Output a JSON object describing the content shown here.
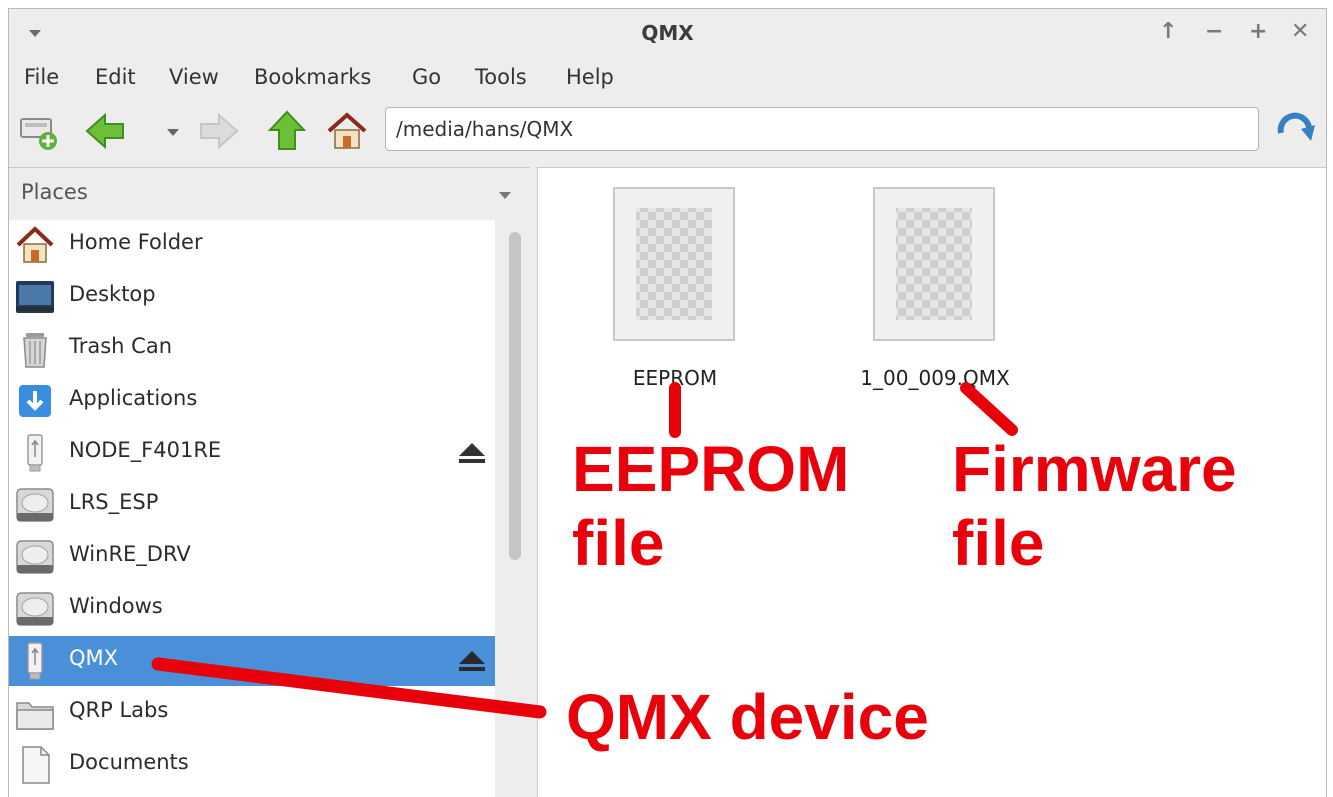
{
  "window": {
    "title": "QMX",
    "controls": [
      "↑",
      "−",
      "+",
      "✕"
    ]
  },
  "menubar": {
    "items": [
      "File",
      "Edit",
      "View",
      "Bookmarks",
      "Go",
      "Tools",
      "Help"
    ]
  },
  "toolbar": {
    "path": "/media/hans/QMX",
    "icons": [
      "new-tab-icon",
      "back-arrow-icon",
      "history-dropdown-icon",
      "forward-arrow-icon",
      "up-arrow-icon",
      "home-icon",
      "go-refresh-icon"
    ]
  },
  "sidebar": {
    "header": "Places",
    "items": [
      {
        "label": "Home Folder",
        "icon": "home-icon"
      },
      {
        "label": "Desktop",
        "icon": "desktop-icon"
      },
      {
        "label": "Trash Can",
        "icon": "trash-icon"
      },
      {
        "label": "Applications",
        "icon": "applications-icon"
      },
      {
        "label": "NODE_F401RE",
        "icon": "usb-drive-icon",
        "eject": true
      },
      {
        "label": "LRS_ESP",
        "icon": "hard-drive-icon"
      },
      {
        "label": "WinRE_DRV",
        "icon": "hard-drive-icon"
      },
      {
        "label": "Windows",
        "icon": "hard-drive-icon"
      },
      {
        "label": "QMX",
        "icon": "usb-drive-icon",
        "eject": true,
        "selected": true
      },
      {
        "label": "QRP Labs",
        "icon": "folder-icon"
      },
      {
        "label": "Documents",
        "icon": "document-icon"
      }
    ]
  },
  "files": [
    {
      "name": "EEPROM",
      "icon": "generic-file-icon"
    },
    {
      "name": "1_00_009.QMX",
      "icon": "generic-file-icon"
    }
  ],
  "annotations": {
    "eeprom_line1": "EEPROM",
    "eeprom_line2": "file",
    "firmware_line1": "Firmware",
    "firmware_line2": "file",
    "device": "QMX device",
    "color": "#e8000a"
  },
  "colors": {
    "selection": "#4a90d9",
    "window_bg": "#ededed"
  }
}
